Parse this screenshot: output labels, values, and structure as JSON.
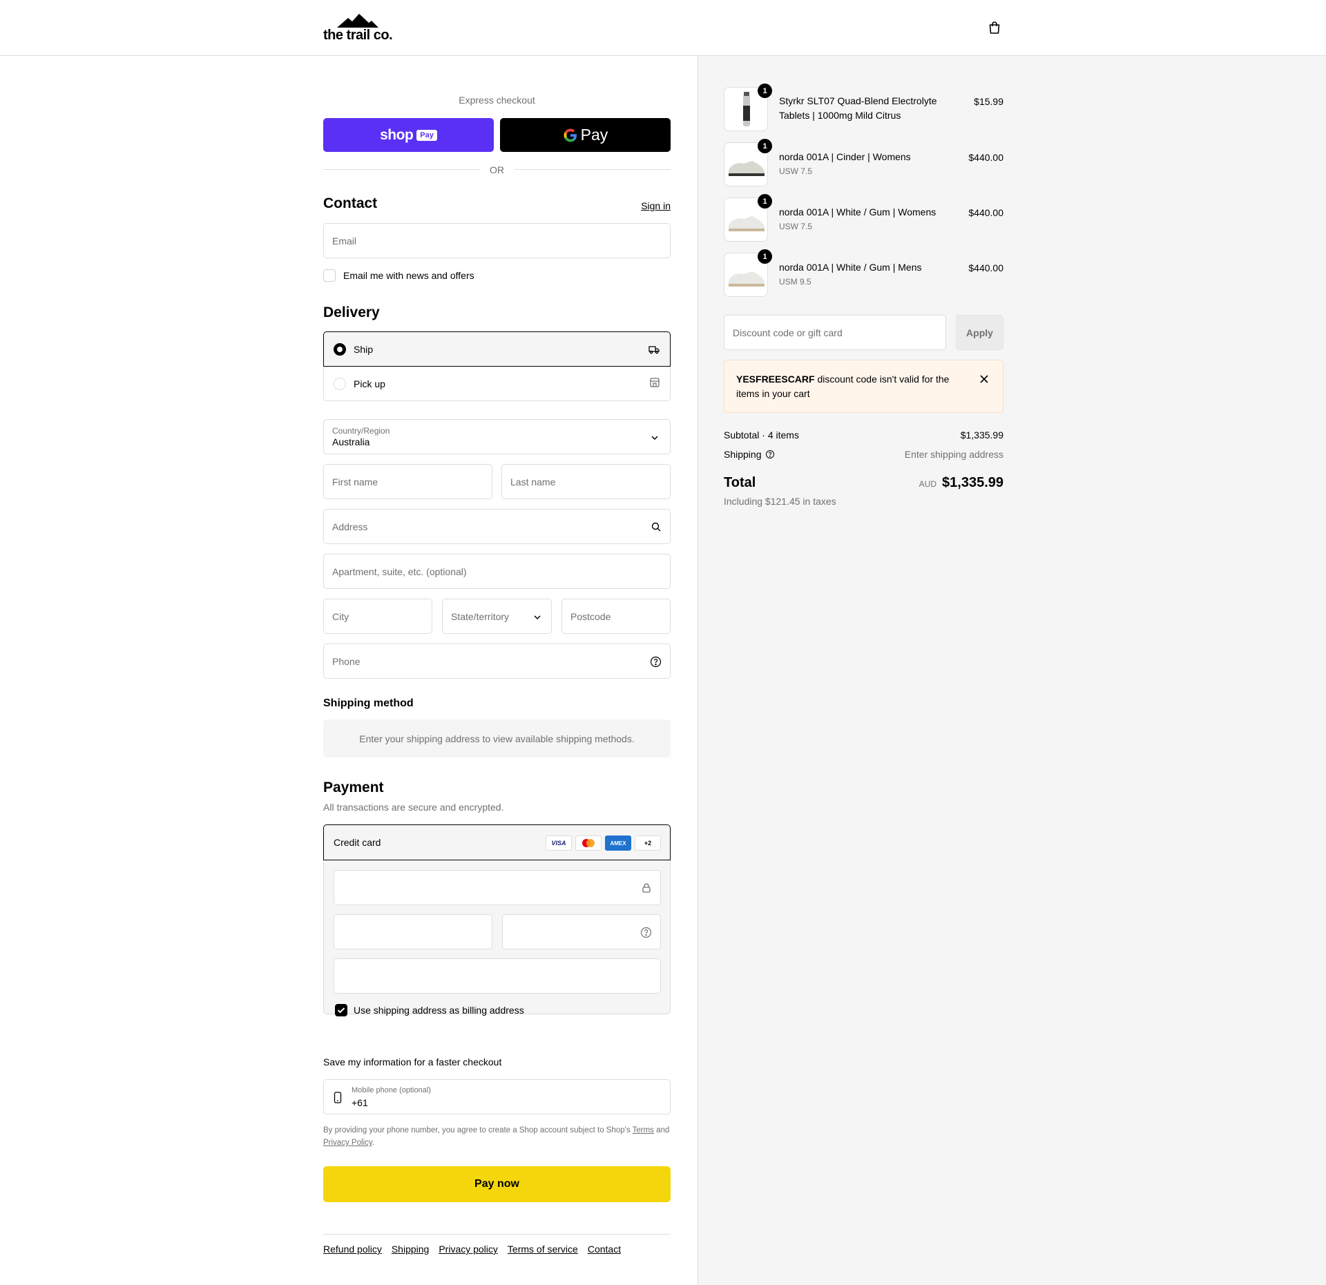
{
  "brand": {
    "name": "the trail co."
  },
  "express": {
    "title": "Express checkout",
    "shoppay_label": "shop",
    "shoppay_badge": "Pay",
    "gpay_label": "Pay",
    "or_label": "OR"
  },
  "contact": {
    "heading": "Contact",
    "signin": "Sign in",
    "email_placeholder": "Email",
    "news_label": "Email me with news and offers",
    "news_checked": false
  },
  "delivery": {
    "heading": "Delivery",
    "options": [
      {
        "label": "Ship",
        "selected": true,
        "icon": "truck-icon"
      },
      {
        "label": "Pick up",
        "selected": false,
        "icon": "store-icon"
      }
    ],
    "country_label": "Country/Region",
    "country_value": "Australia",
    "first_name": "First name",
    "last_name": "Last name",
    "address": "Address",
    "apartment": "Apartment, suite, etc. (optional)",
    "city": "City",
    "state": "State/territory",
    "postcode": "Postcode",
    "phone": "Phone"
  },
  "shipping_method": {
    "heading": "Shipping method",
    "note": "Enter your shipping address to view available shipping methods."
  },
  "payment": {
    "heading": "Payment",
    "subtitle": "All transactions are secure and encrypted.",
    "method": "Credit card",
    "cards": [
      "VISA",
      "mastercard",
      "AMEX",
      "+2"
    ],
    "billing_same_label": "Use shipping address as billing address",
    "billing_same_checked": true
  },
  "save_info": {
    "heading": "Save my information for a faster checkout",
    "mobile_label": "Mobile phone (optional)",
    "mobile_value": "+61",
    "disclaimer_pre": "By providing your phone number, you agree to create a Shop account subject to Shop's",
    "terms": "Terms",
    "and": "and",
    "privacy": "Privacy Policy",
    "period": "."
  },
  "pay_now": "Pay now",
  "footer": [
    "Refund policy",
    "Shipping",
    "Privacy policy",
    "Terms of service",
    "Contact"
  ],
  "cart": {
    "items": [
      {
        "name": "Styrkr SLT07 Quad-Blend Electrolyte Tablets | 1000mg Mild Citrus",
        "variant": "",
        "price": "$15.99",
        "qty": "1"
      },
      {
        "name": "norda 001A | Cinder | Womens",
        "variant": "USW 7.5",
        "price": "$440.00",
        "qty": "1"
      },
      {
        "name": "norda 001A | White / Gum | Womens",
        "variant": "USW 7.5",
        "price": "$440.00",
        "qty": "1"
      },
      {
        "name": "norda 001A | White / Gum | Mens",
        "variant": "USM 9.5",
        "price": "$440.00",
        "qty": "1"
      }
    ],
    "discount_placeholder": "Discount code or gift card",
    "apply": "Apply",
    "alert_code": "YESFREESCARF",
    "alert_msg": " discount code isn't valid for the items in your cart",
    "subtotal_label": "Subtotal · 4 items",
    "subtotal_value": "$1,335.99",
    "shipping_label": "Shipping",
    "shipping_value": "Enter shipping address",
    "total_label": "Total",
    "currency": "AUD",
    "total_value": "$1,335.99",
    "taxes": "Including $121.45 in taxes"
  },
  "colors": {
    "shoppay": "#5a31f4",
    "pay_now": "#f5d60c",
    "alert_bg": "#fff5eb"
  }
}
